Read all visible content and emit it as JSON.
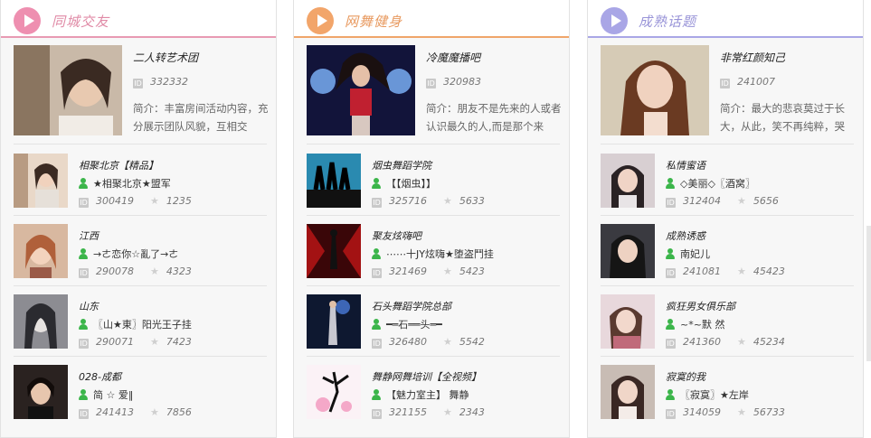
{
  "panels": [
    {
      "title": "同城交友",
      "featured": {
        "name": "二人转艺术团",
        "id": "332332",
        "desc": "简介：丰富房间活动内容，充分展示团队风貌，互相交"
      },
      "items": [
        {
          "name": "相聚北京【精品】",
          "user": "★相聚北京★盟军",
          "id": "300419",
          "count": "1235"
        },
        {
          "name": "江西",
          "user": "→ㄜ恋你☆亂了→ㄜ",
          "id": "290078",
          "count": "4323"
        },
        {
          "name": "山东",
          "user": "〖山★東〗阳光王子挂",
          "id": "290071",
          "count": "7423"
        },
        {
          "name": "028-成都",
          "user": "简 ☆ 爱‖",
          "id": "241413",
          "count": "7856"
        }
      ]
    },
    {
      "title": "网舞健身",
      "featured": {
        "name": "冷魔魔播吧",
        "id": "320983",
        "desc": "简介：朋友不是先来的人或者认识最久的人,而是那个来"
      },
      "items": [
        {
          "name": "烟虫舞蹈学院",
          "user": "【【烟虫】】",
          "id": "325716",
          "count": "5633"
        },
        {
          "name": "聚友炫嗨吧",
          "user": "⋯⋯十JY炫嗨★堕盗鬥挂",
          "id": "321469",
          "count": "5423"
        },
        {
          "name": "石头舞蹈学院总部",
          "user": "━═石══头═━",
          "id": "326480",
          "count": "5542"
        },
        {
          "name": "舞静网舞培训【全视频】",
          "user": "【魅力室主】 舞静",
          "id": "321155",
          "count": "2343"
        }
      ]
    },
    {
      "title": "成熟话题",
      "featured": {
        "name": "非常红颜知己",
        "id": "241007",
        "desc": "简介：最大的悲哀莫过于长大，从此，笑不再纯粹，哭"
      },
      "items": [
        {
          "name": "私情蜜语",
          "user": "◇美丽◇〖酒窝〗",
          "id": "312404",
          "count": "5656"
        },
        {
          "name": "成熟诱惑",
          "user": "南妃儿",
          "id": "241081",
          "count": "45423"
        },
        {
          "name": "疯狂男女俱乐部",
          "user": "~*~默 然",
          "id": "241360",
          "count": "45234"
        },
        {
          "name": "寂寞的我",
          "user": "〖寂寞〗★左岸",
          "id": "314059",
          "count": "56733"
        }
      ]
    }
  ],
  "colors": {
    "pink": "#ee8fb0",
    "orange": "#f2a56a",
    "purple": "#a9a6e6",
    "user_green": "#3bb54a"
  },
  "icons": {
    "header": "play-icon",
    "user": "user-icon",
    "id": "id-icon",
    "count": "star-icon"
  }
}
